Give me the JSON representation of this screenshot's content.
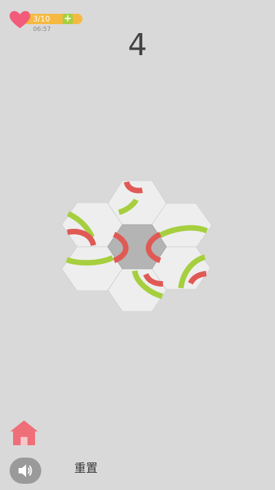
{
  "status": {
    "lives_text": "3/10",
    "timer": "06:57"
  },
  "level_number": "4",
  "buttons": {
    "reset_label": "重置"
  },
  "colors": {
    "background": "#d9d9d9",
    "tile": "#eeeeee",
    "center_tile": "#b4b4b4",
    "red_arc": "#e05a55",
    "green_arc": "#a6cf3f",
    "heart": "#f25b7a",
    "lives_bar": "#f5b942",
    "home": "#ef6f78"
  },
  "icons": {
    "lives": "heart-icon",
    "add": "plus-icon",
    "home": "home-icon",
    "sound": "speaker-icon"
  }
}
